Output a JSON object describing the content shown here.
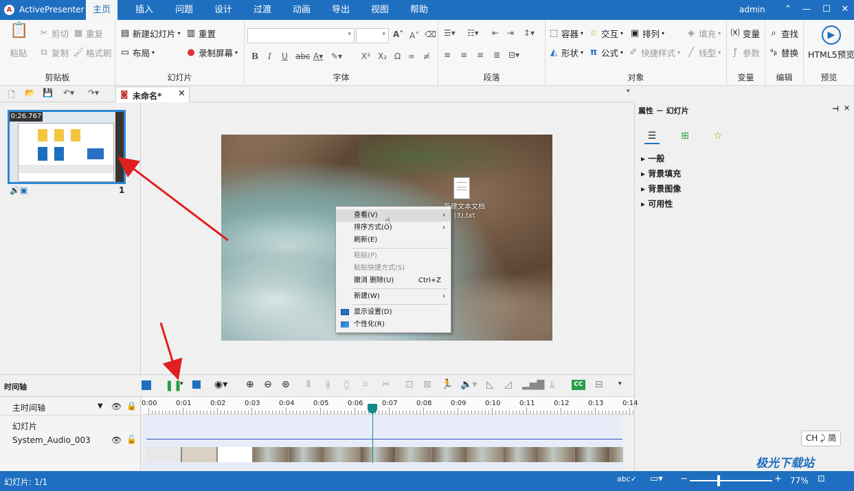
{
  "app": {
    "title": "ActivePresenter",
    "user": "admin"
  },
  "menu": [
    "主页",
    "插入",
    "问题",
    "设计",
    "过渡",
    "动画",
    "导出",
    "视图",
    "帮助"
  ],
  "ribbon": {
    "clipboard": {
      "label": "剪贴板",
      "paste": "粘贴",
      "cut": "剪切",
      "copy": "复制",
      "repeat": "重复",
      "format_painter": "格式刷"
    },
    "slides": {
      "label": "幻灯片",
      "new_slide": "新建幻灯片",
      "reset": "重置",
      "layout": "布局",
      "record_screen": "录制屏幕"
    },
    "font": {
      "label": "字体"
    },
    "paragraph": {
      "label": "段落"
    },
    "objects": {
      "label": "对象",
      "container": "容器",
      "interaction": "交互",
      "arrange": "排列",
      "fill": "填充",
      "shape": "形状",
      "formula": "公式",
      "quick_style": "快捷样式",
      "line_type": "线型"
    },
    "variables": {
      "label": "变量",
      "variable": "变量",
      "parameter": "参数"
    },
    "edit": {
      "label": "编辑",
      "find": "查找",
      "replace": "替换"
    },
    "preview": {
      "label": "预览",
      "html5": "HTML5预览"
    }
  },
  "document_tab": "未命名*",
  "slide_thumb": {
    "duration": "0:26.767",
    "number": "1"
  },
  "desktop": {
    "file_name_line1": "新建文本文档",
    "file_name_line2": "(3).txt"
  },
  "context_menu": [
    {
      "label": "查看(V)",
      "arrow": "›",
      "disabled": false,
      "hover": true
    },
    {
      "label": "排序方式(O)",
      "arrow": "›",
      "disabled": false
    },
    {
      "label": "刷新(E)",
      "disabled": false
    },
    {
      "label": "粘贴(P)",
      "disabled": true
    },
    {
      "label": "粘贴快捷方式(S)",
      "disabled": true
    },
    {
      "label": "撤消 删除(U)",
      "shortcut": "Ctrl+Z",
      "disabled": false
    },
    {
      "label": "新建(W)",
      "arrow": "›",
      "disabled": false
    },
    {
      "label": "显示设置(D)",
      "disabled": false
    },
    {
      "label": "个性化(R)",
      "disabled": false
    }
  ],
  "properties": {
    "title": "属性 － 幻灯片",
    "sections": [
      "一般",
      "背景填充",
      "背景图像",
      "可用性"
    ]
  },
  "timeline": {
    "label": "时间轴",
    "main_timeline": "主时间轴",
    "track_slide": "幻灯片",
    "track_audio": "System_Audio_003",
    "ticks": [
      "0:00",
      "0:01",
      "0:02",
      "0:03",
      "0:04",
      "0:05",
      "0:06",
      "0:07",
      "0:08",
      "0:09",
      "0:10",
      "0:11",
      "0:12",
      "0:13",
      "0:14"
    ]
  },
  "status": {
    "slide_count": "幻灯片: 1/1",
    "zoom": "77%",
    "ime": "CH ⤸ 简",
    "watermark": "极光下载站"
  },
  "colors": {
    "brand_blue": "#1e6fbf",
    "accent_teal": "#138a8a",
    "arrow_red": "#e02020",
    "thumb_border": "#2b88d8"
  }
}
